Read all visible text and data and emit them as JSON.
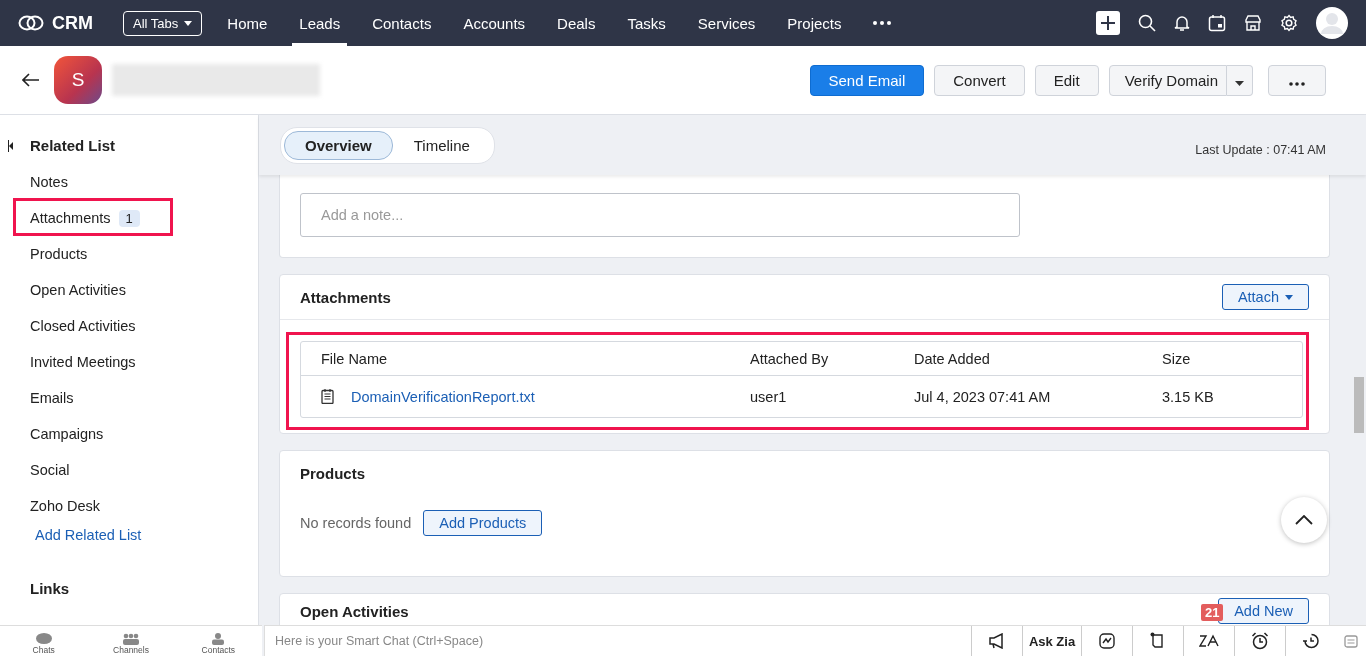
{
  "app": {
    "name": "CRM",
    "all_tabs": "All Tabs"
  },
  "nav_tabs": [
    {
      "label": "Home",
      "selected": false
    },
    {
      "label": "Leads",
      "selected": true
    },
    {
      "label": "Contacts",
      "selected": false
    },
    {
      "label": "Accounts",
      "selected": false
    },
    {
      "label": "Deals",
      "selected": false
    },
    {
      "label": "Tasks",
      "selected": false
    },
    {
      "label": "Services",
      "selected": false
    },
    {
      "label": "Projects",
      "selected": false
    }
  ],
  "record": {
    "avatar_letter": "S"
  },
  "actions": {
    "send_email": "Send Email",
    "convert": "Convert",
    "edit": "Edit",
    "verify_domain": "Verify Domain"
  },
  "sidebar": {
    "title": "Related List",
    "items": [
      {
        "label": "Notes",
        "highlighted": false
      },
      {
        "label": "Attachments",
        "badge": "1",
        "highlighted": true
      },
      {
        "label": "Products",
        "highlighted": false
      },
      {
        "label": "Open Activities",
        "highlighted": false
      },
      {
        "label": "Closed Activities",
        "highlighted": false
      },
      {
        "label": "Invited Meetings",
        "highlighted": false
      },
      {
        "label": "Emails",
        "highlighted": false
      },
      {
        "label": "Campaigns",
        "highlighted": false
      },
      {
        "label": "Social",
        "highlighted": false
      },
      {
        "label": "Zoho Desk",
        "highlighted": false
      }
    ],
    "add_link": "Add Related List",
    "links_title": "Links"
  },
  "view_tabs": [
    {
      "label": "Overview",
      "selected": true
    },
    {
      "label": "Timeline",
      "selected": false
    }
  ],
  "last_update": "Last Update : 07:41 AM",
  "notes": {
    "placeholder": "Add a note..."
  },
  "attachments": {
    "title": "Attachments",
    "attach_button": "Attach",
    "highlighted": true,
    "columns": [
      "File Name",
      "Attached By",
      "Date Added",
      "Size"
    ],
    "rows": [
      {
        "file_name": "DomainVerificationReport.txt",
        "attached_by": "user1",
        "date_added": "Jul 4, 2023 07:41 AM",
        "size": "3.15 KB"
      }
    ]
  },
  "products": {
    "title": "Products",
    "empty": "No records found",
    "add_button": "Add Products"
  },
  "open_activities": {
    "title": "Open Activities",
    "add_button": "Add New"
  },
  "bottom_bar": {
    "chats": "Chats",
    "channels": "Channels",
    "contacts": "Contacts",
    "smart_chat": {
      "placeholder": "Here is your Smart Chat (Ctrl+Space)"
    },
    "ask_zia": "Ask Zia",
    "badge": "21"
  }
}
